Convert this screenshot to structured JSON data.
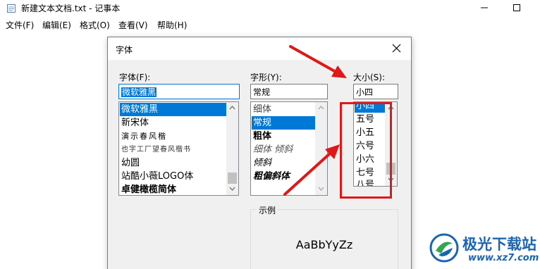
{
  "window": {
    "title": "新建文本文档.txt - 记事本",
    "icon": "notepad-icon"
  },
  "menubar": {
    "items": [
      "文件(F)",
      "编辑(E)",
      "格式(O)",
      "查看(V)",
      "帮助(H)"
    ]
  },
  "font_dialog": {
    "title": "字体",
    "font": {
      "label": "字体(F):",
      "value": "微软雅黑",
      "items": [
        "微软雅黑",
        "新宋体",
        "演示春风楷",
        "也字工厂望春风楷书",
        "幼圆",
        "站酷小薇LOGO体",
        "卓健橄榄简体"
      ],
      "selected": "微软雅黑"
    },
    "style": {
      "label": "字形(Y):",
      "value": "常规",
      "items": [
        "细体",
        "常规",
        "粗体",
        "细体 倾斜",
        "倾斜",
        "粗偏斜体"
      ],
      "selected": "常规"
    },
    "size": {
      "label": "大小(S):",
      "value": "小四",
      "items": [
        "小四",
        "五号",
        "小五",
        "六号",
        "小六",
        "七号",
        "八号"
      ],
      "selected": "小四"
    },
    "preview": {
      "label": "示例",
      "sample": "AaBbYyZz"
    }
  },
  "annotation": {
    "color": "#e01818"
  },
  "watermark": {
    "name": "极光下载站",
    "url": "www.xz7.com"
  },
  "colors": {
    "selection": "#0078d7",
    "annotation": "#e01818",
    "watermark": "#1a64b4"
  }
}
